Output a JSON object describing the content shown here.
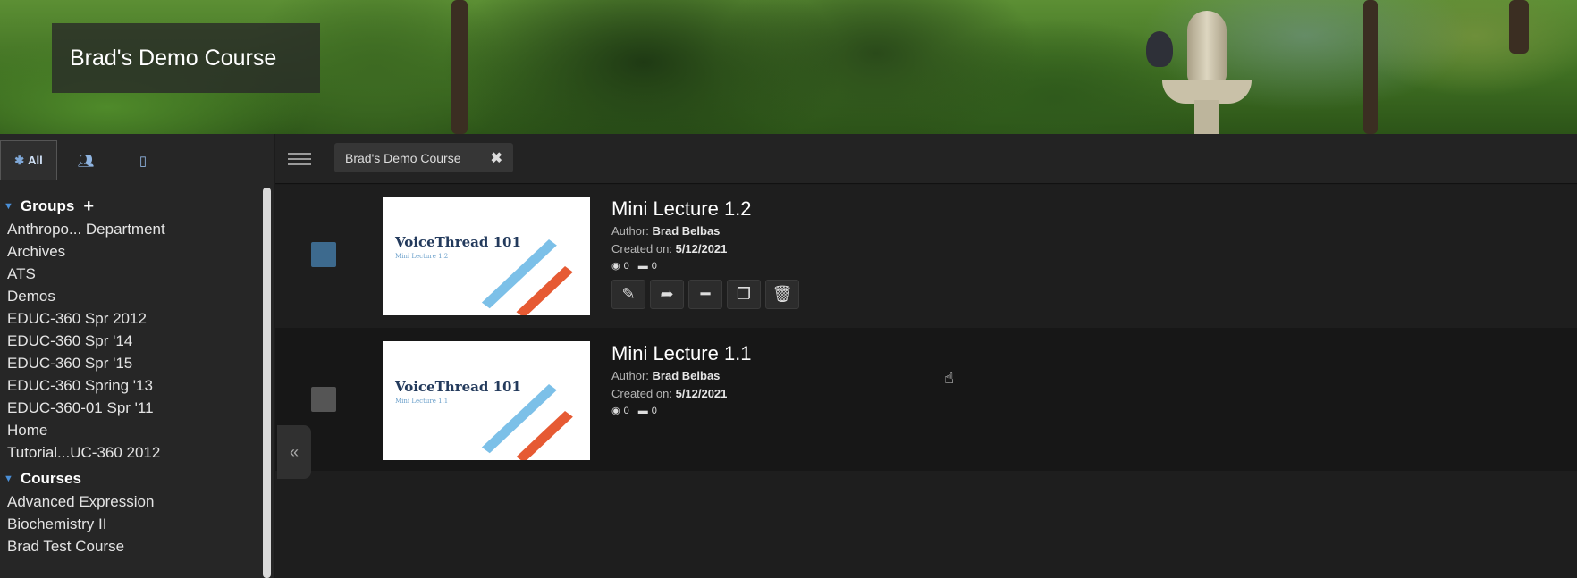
{
  "banner": {
    "course_title": "Brad's Demo Course"
  },
  "sidebar": {
    "tabs": [
      {
        "label": "All",
        "icon": "asterisk-icon",
        "active": true
      },
      {
        "label": "",
        "icon": "people-icon",
        "active": false
      },
      {
        "label": "",
        "icon": "notebook-icon",
        "active": false
      }
    ],
    "groups_header": "Groups",
    "groups": [
      "Anthropo... Department",
      "Archives",
      "ATS",
      "Demos",
      "EDUC-360 Spr 2012",
      "EDUC-360 Spr '14",
      "EDUC-360 Spr '15",
      "EDUC-360 Spring '13",
      "EDUC-360-01 Spr '11",
      "Home",
      "Tutorial...UC-360 2012"
    ],
    "courses_header": "Courses",
    "courses": [
      "Advanced Expression",
      "Biochemistry II",
      "Brad Test Course"
    ]
  },
  "toolbar": {
    "filter_chip": "Brad's Demo Course",
    "chip_close": "✖"
  },
  "threads": [
    {
      "title": "Mini Lecture 1.2",
      "author_label": "Author:",
      "author": "Brad Belbas",
      "created_label": "Created on:",
      "created": "5/12/2021",
      "views": "0",
      "comments": "0",
      "thumb_title": "VoiceThread 101",
      "thumb_subtitle": "Mini Lecture 1.2",
      "selected": true
    },
    {
      "title": "Mini Lecture 1.1",
      "author_label": "Author:",
      "author": "Brad Belbas",
      "created_label": "Created on:",
      "created": "5/12/2021",
      "views": "0",
      "comments": "0",
      "thumb_title": "VoiceThread 101",
      "thumb_subtitle": "Mini Lecture 1.1",
      "selected": false
    }
  ],
  "collapse_label": "«",
  "colors": {
    "accent": "#4a8fd8",
    "selected_checkbox": "#3d6a8e",
    "stripe_blue": "#7cc0e8",
    "stripe_red": "#e65a33"
  }
}
